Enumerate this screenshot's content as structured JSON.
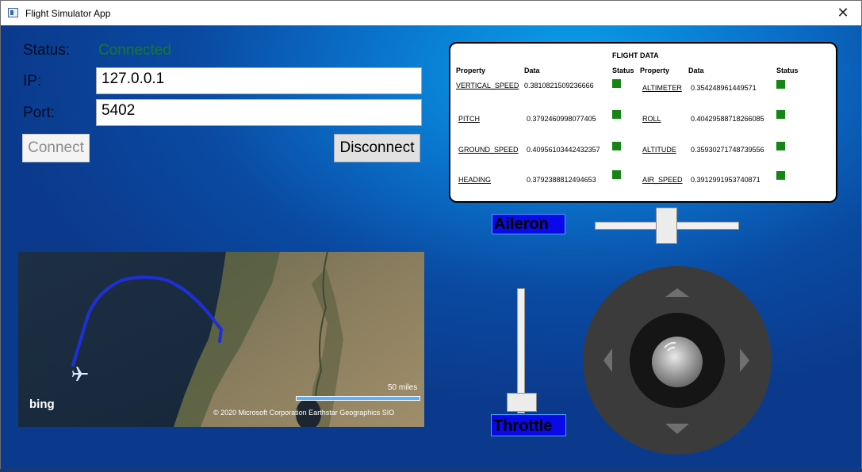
{
  "window": {
    "title": "Flight Simulator App",
    "close_glyph": "✕",
    "icon": "app-window-icon"
  },
  "connection": {
    "status_label": "Status:",
    "status_value": "Connected",
    "status_color": "#157a2a",
    "ip_label": "IP:",
    "ip_value": "127.0.0.1",
    "port_label": "Port:",
    "port_value": "5402",
    "connect_label": "Connect",
    "disconnect_label": "Disconnect"
  },
  "flight_data": {
    "title": "FLIGHT DATA",
    "headers": {
      "property": "Property",
      "data": "Data",
      "status": "Status"
    },
    "left": [
      {
        "property": "VERTICAL_SPEED",
        "value": "0.3810821509236666",
        "status_color": "#168516"
      },
      {
        "property": "PITCH",
        "value": "0.3792460998077405",
        "status_color": "#168516"
      },
      {
        "property": "GROUND_SPEED",
        "value": "0.40956103442432357",
        "status_color": "#168516"
      },
      {
        "property": "HEADING",
        "value": "0.3792388812494653",
        "status_color": "#168516"
      }
    ],
    "right": [
      {
        "property": "ALTIMETER",
        "value": "0.354248961449571",
        "status_color": "#168516"
      },
      {
        "property": "ROLL",
        "value": "0.40429588718266085",
        "status_color": "#168516"
      },
      {
        "property": "ALTITUDE",
        "value": "0.35930271748739556",
        "status_color": "#168516"
      },
      {
        "property": "AIR_SPEED",
        "value": "0.3912991953740871",
        "status_color": "#168516"
      }
    ]
  },
  "controls": {
    "aileron_label": "Aileron",
    "throttle_label": "Throttle",
    "aileron_value": 0.5,
    "throttle_value": 0.0,
    "label_bg_color": "#0a0ae8"
  },
  "map": {
    "logo": "bing",
    "scale_label": "50 miles",
    "copyright": "© 2020 Microsoft Corporation   Earthstar Geographics  SIO",
    "route_color": "#1f2fd8",
    "marker_icon": "airplane-icon"
  },
  "joystick": {
    "arrows": [
      "up-arrow-icon",
      "down-arrow-icon",
      "left-arrow-icon",
      "right-arrow-icon"
    ]
  }
}
